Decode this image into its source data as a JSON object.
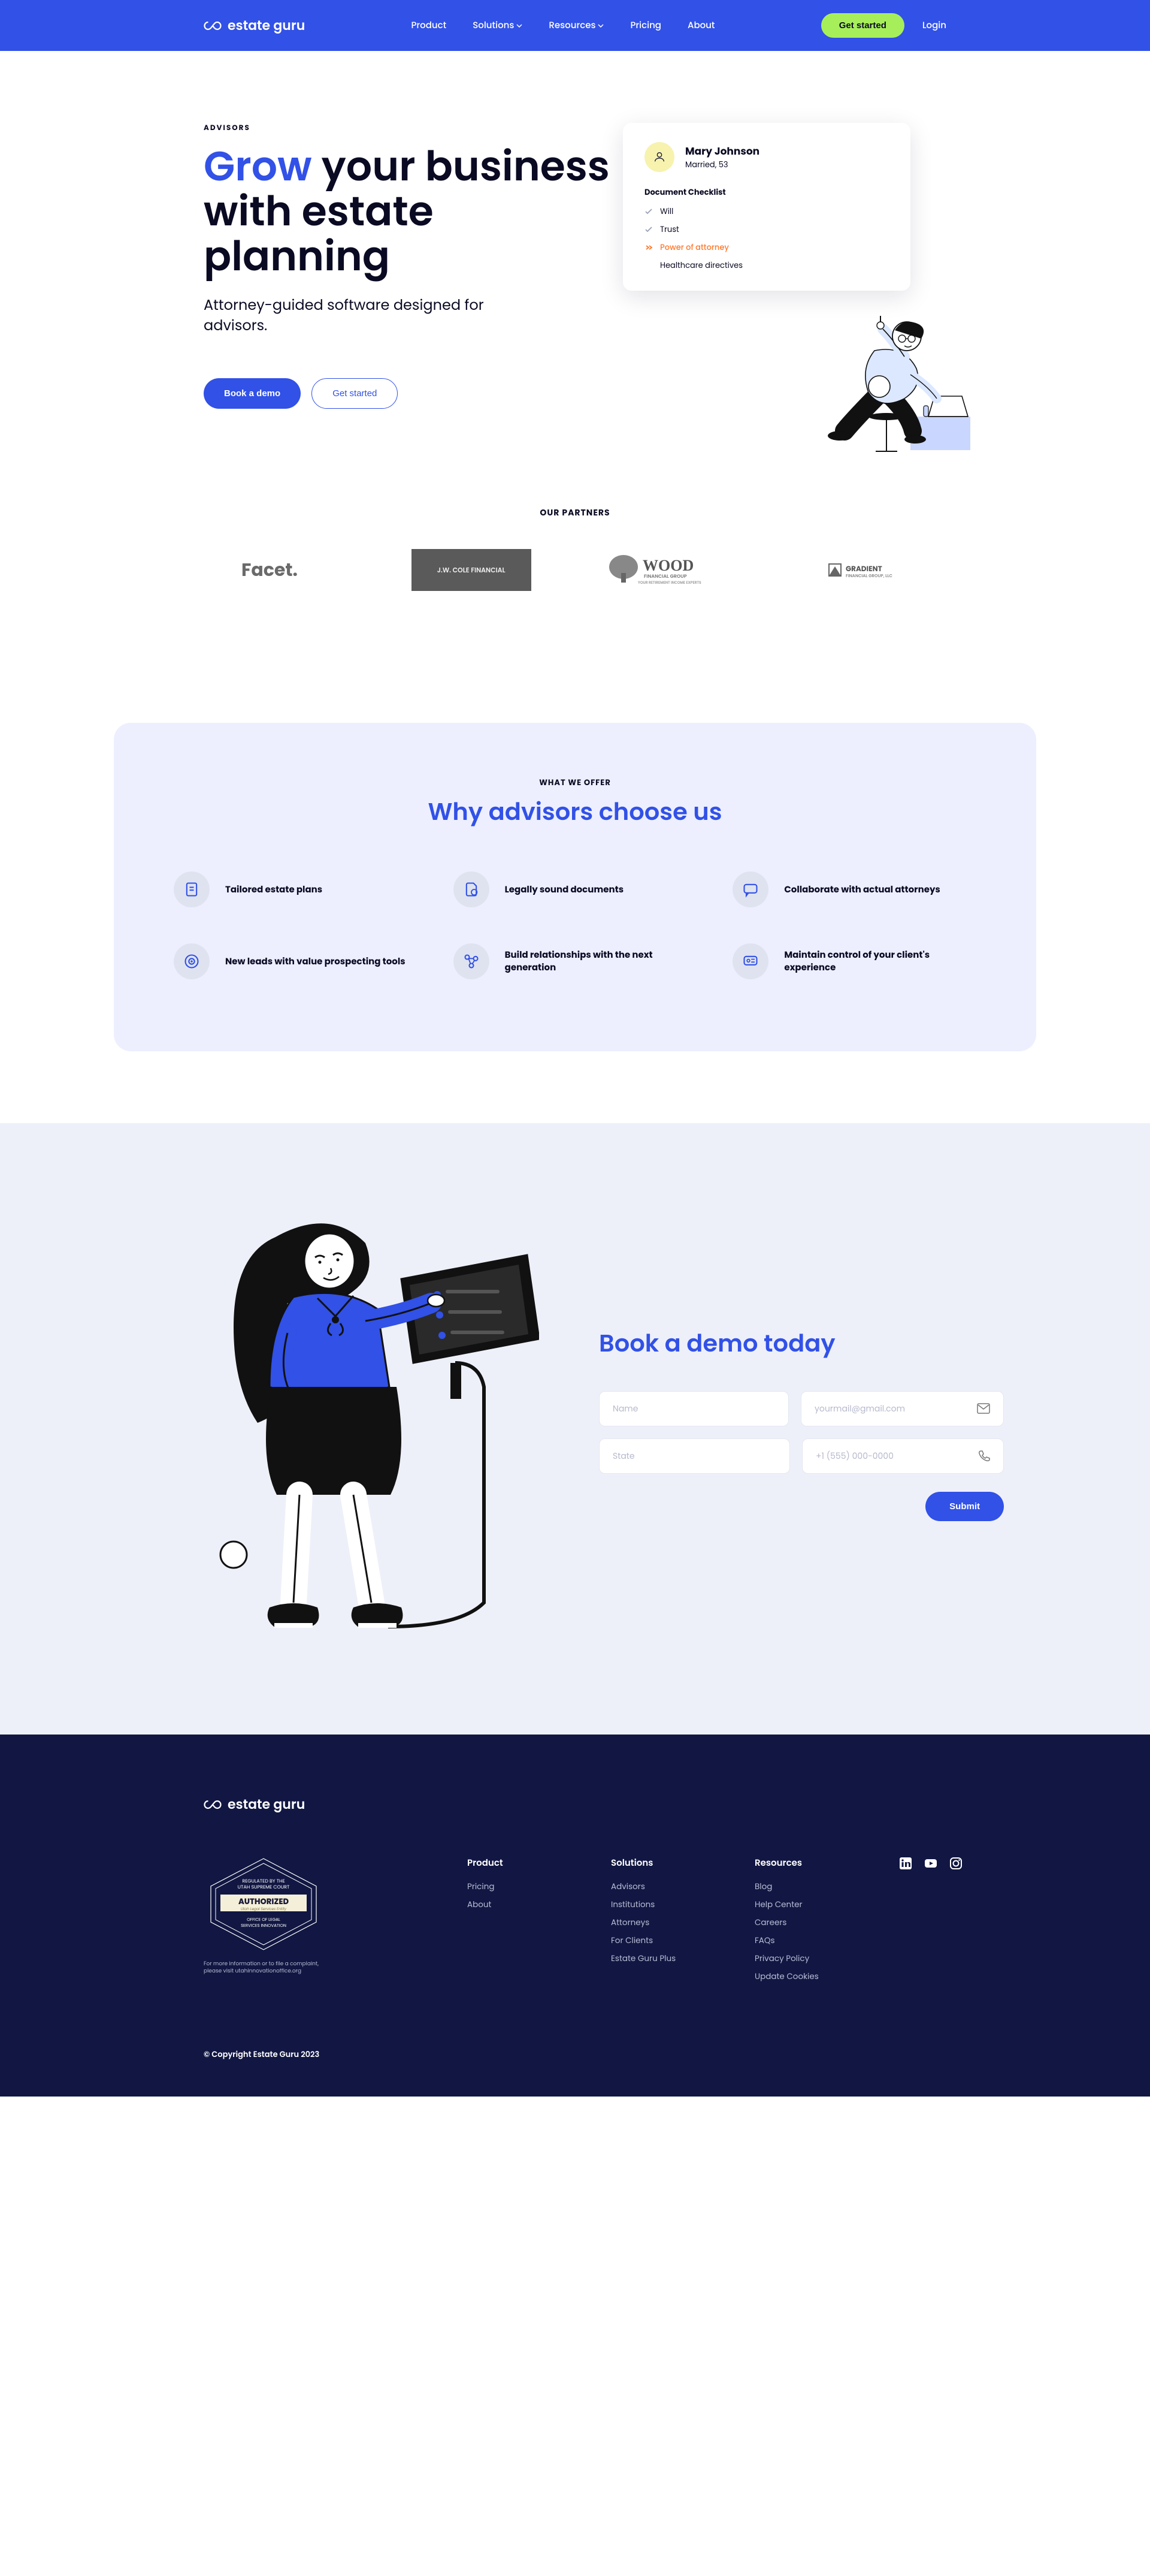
{
  "brand": "estate guru",
  "nav": {
    "product": "Product",
    "solutions": "Solutions",
    "resources": "Resources",
    "pricing": "Pricing",
    "about": "About"
  },
  "cta": {
    "get_started": "Get started",
    "login": "Login"
  },
  "hero": {
    "eyebrow": "ADVISORS",
    "accent": "Grow",
    "rest": "your business with estate planning",
    "sub": "Attorney-guided software designed for advisors.",
    "book": "Book a demo",
    "start": "Get started"
  },
  "card": {
    "name": "Mary Johnson",
    "meta": "Married, 53",
    "heading": "Document Checklist",
    "items": [
      {
        "label": "Will",
        "done": true
      },
      {
        "label": "Trust",
        "done": true
      },
      {
        "label": "Power of attorney",
        "done": false
      },
      {
        "label": "Healthcare directives",
        "done": null
      }
    ]
  },
  "partners": {
    "label": "OUR PARTNERS",
    "logos": [
      "Facet.",
      "J.W. COLE FINANCIAL",
      "WOOD Financial Group",
      "GRADIENT Financial Group, LLC"
    ]
  },
  "offer": {
    "eyebrow": "WHAT WE OFFER",
    "title": "Why advisors choose us",
    "features": [
      "Tailored estate plans",
      "Legally sound documents",
      "Collaborate with actual attorneys",
      "New leads with value prospecting tools",
      "Build relationships with the next generation",
      "Maintain control of your client's experience"
    ]
  },
  "demo": {
    "title": "Book a demo today",
    "name_ph": "Name",
    "email_ph": "yourmail@gmail.com",
    "state_ph": "State",
    "phone_ph": "+1 (555) 000-0000",
    "submit": "Submit"
  },
  "footer": {
    "badge_lines": [
      "REGULATED BY THE",
      "UTAH SUPREME COURT",
      "AUTHORIZED",
      "Utah Legal Services Entity",
      "OFFICE OF LEGAL",
      "SERVICES INNOVATION"
    ],
    "badge_info": "For more information or to file a complaint, please visit utahinnovationoffice.org",
    "cols": [
      {
        "h": "Product",
        "links": [
          "Pricing",
          "About"
        ]
      },
      {
        "h": "Solutions",
        "links": [
          "Advisors",
          "Institutions",
          "Attorneys",
          "For Clients",
          "Estate Guru Plus"
        ]
      },
      {
        "h": "Resources",
        "links": [
          "Blog",
          "Help Center",
          "Careers",
          "FAQs",
          "Privacy Policy",
          "Update Cookies"
        ]
      }
    ],
    "copy": "© Copyright Estate Guru 2023"
  },
  "colors": {
    "brand": "#3151e7",
    "green": "#a7ef5a",
    "footer": "#111742",
    "offer_bg": "#edefff",
    "demo_bg": "#eef0f9"
  }
}
